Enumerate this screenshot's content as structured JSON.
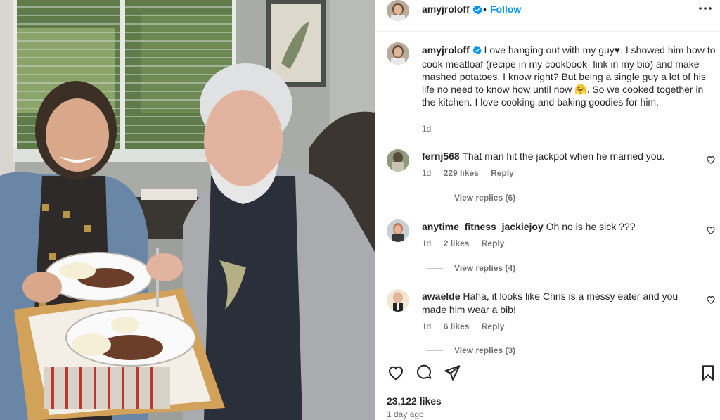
{
  "post": {
    "username": "amyjroloff",
    "dot": "•",
    "follow_label": "Follow",
    "more_icon": "more-options-icon",
    "verified_icon": "verified-badge-icon",
    "caption": {
      "username": "amyjroloff",
      "text": "Love hanging out with my guy♥. I showed him how to cook meatloaf (recipe in my cookbook- link in my bio) and make mashed potatoes. I know right? But being a single guy a lot of his life no need to know how until now 🤗. So we cooked together in the kitchen. I love cooking and baking goodies for him.",
      "time": "1d"
    },
    "comments": [
      {
        "username": "fernj568",
        "text": "That man hit the jackpot when he married you.",
        "time": "1d",
        "likes": "229 likes",
        "reply_label": "Reply",
        "view_replies": "View replies (6)"
      },
      {
        "username": "anytime_fitness_jackiejoy",
        "text": "Oh no is he sick ???",
        "time": "1d",
        "likes": "2 likes",
        "reply_label": "Reply",
        "view_replies": "View replies (4)"
      },
      {
        "username": "awaelde",
        "text": "Haha, it looks like Chris is a messy eater and you made him wear a bib!",
        "time": "1d",
        "likes": "6 likes",
        "reply_label": "Reply",
        "view_replies": "View replies (3)"
      }
    ],
    "like_count": "23,122 likes",
    "posted": "1 day ago",
    "action_icons": [
      "heart-icon",
      "comment-icon",
      "share-icon",
      "bookmark-icon"
    ]
  },
  "colors": {
    "follow_blue": "#0095f6",
    "verified_blue": "#0095f6",
    "text_primary": "#262626",
    "text_secondary": "#737373"
  }
}
